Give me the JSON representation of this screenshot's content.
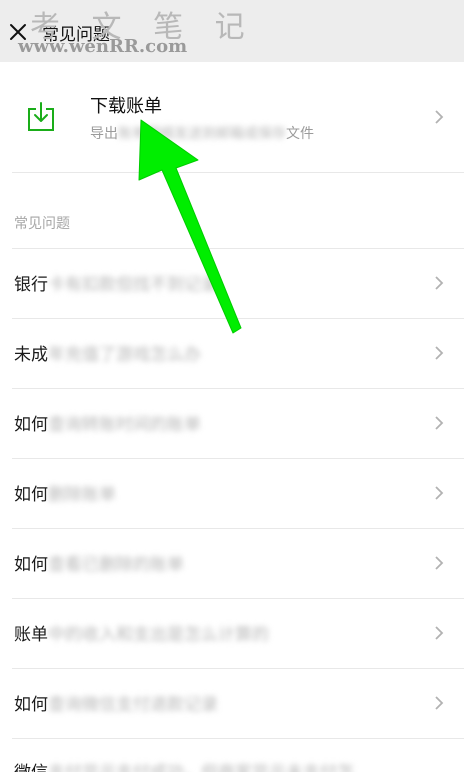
{
  "header": {
    "title": "常见问题",
    "close_icon": "close-icon",
    "watermark_cn": "考 文 笔 记",
    "watermark_url": "www.wenRR.com"
  },
  "download": {
    "title": "下载账单",
    "desc_prefix": "导出",
    "desc_blurred": "账单明细发送到邮箱或保存",
    "desc_suffix": "文件",
    "icon": "download-tray-icon",
    "icon_color": "#1aad19"
  },
  "faq": {
    "section_title": "常见问题",
    "items": [
      {
        "visible": "银行",
        "blurred": "卡有扣款但找不到记录"
      },
      {
        "visible": "未成",
        "blurred": "年充值了游戏怎么办"
      },
      {
        "visible": "如何",
        "blurred": "查询转账时间的账单"
      },
      {
        "visible": "如何",
        "blurred": "删除账单"
      },
      {
        "visible": "如何",
        "blurred": "查看已删除的账单"
      },
      {
        "visible": "账单",
        "blurred": "中的收入和支出是怎么计算的"
      },
      {
        "visible": "如何",
        "blurred": "查询微信支付退款记录"
      },
      {
        "visible": "微信",
        "blurred": "支付显示支付成功，但商家显示未支付怎"
      }
    ]
  },
  "annotation": {
    "arrow_color": "#00ee00"
  }
}
